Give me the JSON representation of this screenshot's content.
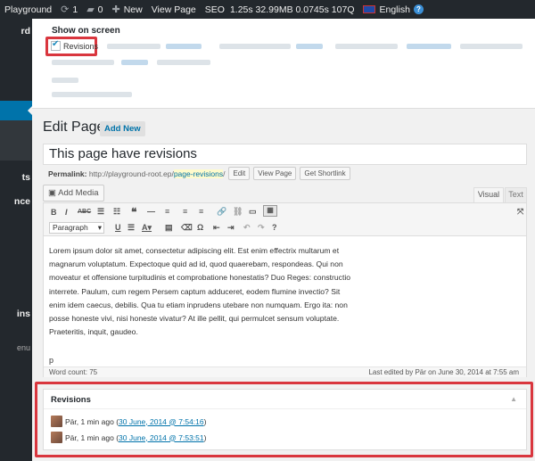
{
  "admin_bar": {
    "site": "Playground",
    "updates_count": "1",
    "comments_count": "0",
    "new_label": "New",
    "view_page": "View Page",
    "seo": "SEO",
    "time": "1.25s",
    "memory": "32.99MB",
    "db_time": "0.0745s",
    "queries": "107Q",
    "language": "English"
  },
  "sidebar": {
    "items": [
      "rd",
      "ts",
      "nce",
      "ins",
      "enu"
    ]
  },
  "screen_options": {
    "title": "Show on screen",
    "revisions_label": "Revisions",
    "revisions_checked": true
  },
  "page": {
    "title": "Edit Page",
    "add_new": "Add New",
    "post_title": "This page have revisions"
  },
  "permalink": {
    "label": "Permalink:",
    "base": "http://playground-root.ep/",
    "slug": "page-revisions",
    "trail": "/",
    "edit_button": "Edit",
    "view_button": "View Page",
    "shortlink_button": "Get Shortlink"
  },
  "editor": {
    "add_media": "Add Media",
    "tab_visual": "Visual",
    "tab_text": "Text",
    "format_select": "Paragraph",
    "toolbar_icons": [
      "bold-icon",
      "italic-icon",
      "strikethrough-icon",
      "bulleted-list-icon",
      "numbered-list-icon",
      "blockquote-icon",
      "horizontal-rule-icon",
      "align-left-icon",
      "align-center-icon",
      "align-right-icon",
      "link-icon",
      "unlink-icon",
      "read-more-icon",
      "toolbar-toggle-icon",
      "underline-icon",
      "justify-icon",
      "text-color-icon",
      "paste-text-icon",
      "clear-formatting-icon",
      "special-character-icon",
      "outdent-icon",
      "indent-icon",
      "undo-icon",
      "redo-icon",
      "help-icon",
      "fullscreen-icon"
    ],
    "content": "Lorem ipsum dolor sit amet, consectetur adipiscing elit. Est enim effectrix multarum et magnarum voluptatum. Expectoque quid ad id, quod quaerebam, respondeas. Qui non moveatur et offensione turpitudinis et comprobatione honestatis? Duo Reges: constructio interrete. Paulum, cum regem Persem captum adduceret, eodem flumine invectio? Sit enim idem caecus, debilis. Qua tu etiam inprudens utebare non numquam. Ergo ita: non posse honeste vivi, nisi honeste vivatur? At ille pellit, qui permulcet sensum voluptate. Praeteritis, inquit, gaudeo.",
    "path": "p",
    "word_count": "Word count: 75",
    "last_edited": "Last edited by Pär on June 30, 2014 at 7:55 am"
  },
  "revisions": {
    "title": "Revisions",
    "items": [
      {
        "author": "Pär, 1 min ago",
        "open": "(",
        "link": "30 June, 2014 @ 7:54:16",
        "close": ")"
      },
      {
        "author": "Pär, 1 min ago",
        "open": "(",
        "link": "30 June, 2014 @ 7:53:51",
        "close": ")"
      }
    ]
  },
  "colors": {
    "admin_bar": "#23282d",
    "accent": "#0073aa",
    "highlight": "#d9363e"
  }
}
